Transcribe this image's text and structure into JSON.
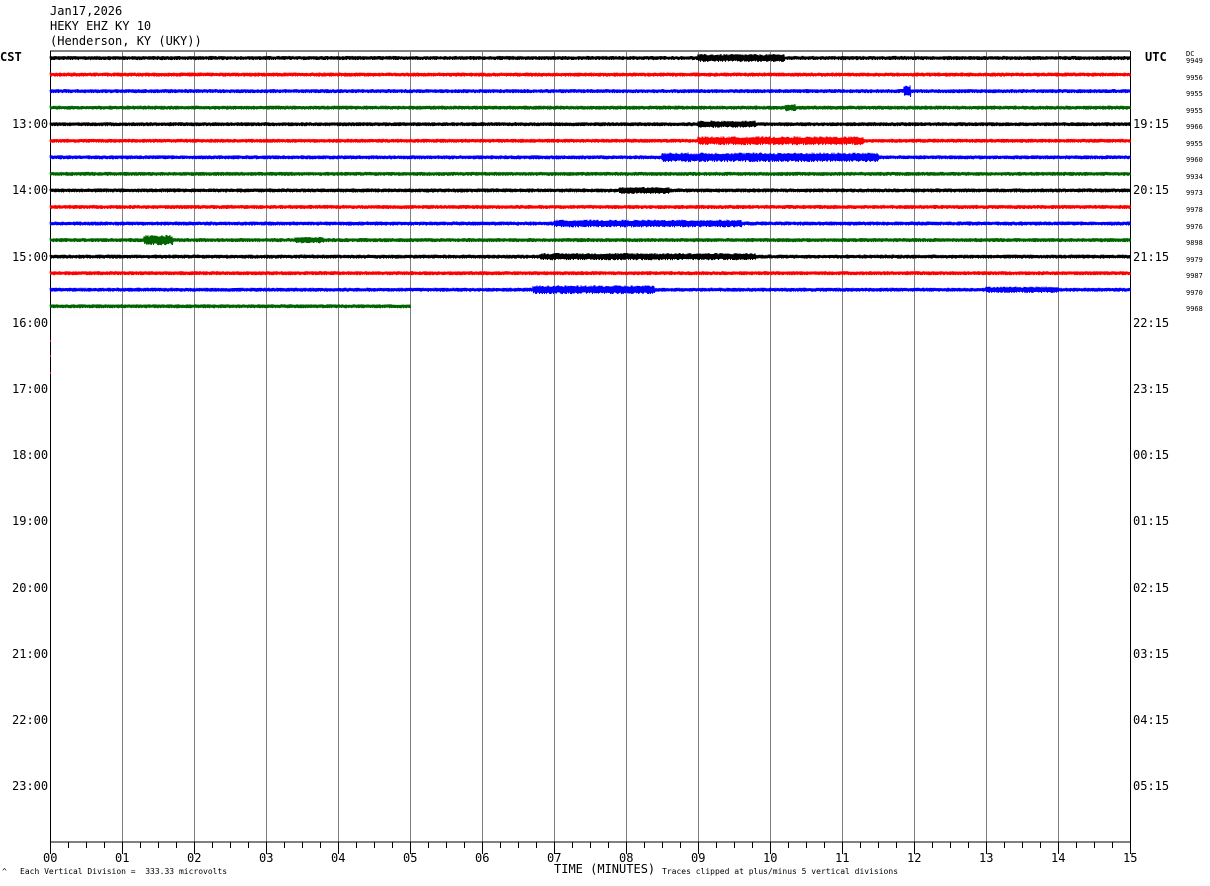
{
  "header": {
    "date": "Jan17,2026",
    "station": "HEKY EHZ KY 10",
    "location": "(Henderson, KY (UKY))"
  },
  "left_zone": "CST",
  "right_zone": "UTC",
  "dc_label": "DC",
  "footer": {
    "xlabel": "TIME (MINUTES)",
    "division_note": "Each Vertical Division =  333.33 microvolts",
    "clip_note": "Traces clipped at plus/minus 5 vertical divisions",
    "corner_mark": "^"
  },
  "chart_data": {
    "type": "line",
    "title": "HEKY EHZ KY 10",
    "xlabel": "TIME (MINUTES)",
    "ylabel": "",
    "xlim": [
      0,
      15
    ],
    "x_ticks": [
      "00",
      "01",
      "02",
      "03",
      "04",
      "05",
      "06",
      "07",
      "08",
      "09",
      "10",
      "11",
      "12",
      "13",
      "14",
      "15"
    ],
    "grid": true,
    "left_hour_labels": [
      "13:00",
      "14:00",
      "15:00",
      "16:00",
      "17:00",
      "18:00",
      "19:00",
      "20:00",
      "21:00",
      "22:00",
      "23:00"
    ],
    "right_hour_labels": [
      "19:15",
      "20:15",
      "21:15",
      "22:15",
      "23:15",
      "00:15",
      "01:15",
      "02:15",
      "03:15",
      "04:15",
      "05:15"
    ],
    "colors": [
      "#000000",
      "#ff0000",
      "#0000ff",
      "#006400"
    ],
    "traces": [
      {
        "row": 0,
        "color": "#000000",
        "end_min": 15,
        "dc": "9949",
        "bursts": [
          [
            9.0,
            10.2,
            2.0
          ]
        ]
      },
      {
        "row": 1,
        "color": "#ff0000",
        "end_min": 15,
        "dc": "9956",
        "bursts": []
      },
      {
        "row": 2,
        "color": "#0000ff",
        "end_min": 15,
        "dc": "9955",
        "bursts": [
          [
            11.85,
            11.95,
            3.0
          ]
        ]
      },
      {
        "row": 3,
        "color": "#006400",
        "end_min": 15,
        "dc": "9955",
        "bursts": [
          [
            10.2,
            10.35,
            1.8
          ]
        ]
      },
      {
        "row": 4,
        "color": "#000000",
        "end_min": 15,
        "dc": "9966",
        "bursts": [
          [
            9.0,
            9.8,
            1.8
          ]
        ]
      },
      {
        "row": 5,
        "color": "#ff0000",
        "end_min": 15,
        "dc": "9955",
        "bursts": [
          [
            9.0,
            11.3,
            2.2
          ]
        ]
      },
      {
        "row": 6,
        "color": "#0000ff",
        "end_min": 15,
        "dc": "9960",
        "bursts": [
          [
            8.5,
            11.5,
            2.4
          ]
        ]
      },
      {
        "row": 7,
        "color": "#006400",
        "end_min": 15,
        "dc": "9934",
        "bursts": []
      },
      {
        "row": 8,
        "color": "#000000",
        "end_min": 15,
        "dc": "9973",
        "bursts": [
          [
            7.9,
            8.6,
            1.7
          ]
        ]
      },
      {
        "row": 9,
        "color": "#ff0000",
        "end_min": 15,
        "dc": "9978",
        "bursts": []
      },
      {
        "row": 10,
        "color": "#0000ff",
        "end_min": 15,
        "dc": "9976",
        "bursts": [
          [
            7.0,
            9.6,
            1.9
          ]
        ]
      },
      {
        "row": 11,
        "color": "#006400",
        "end_min": 15,
        "dc": "9898",
        "bursts": [
          [
            1.3,
            1.7,
            2.6
          ],
          [
            3.4,
            3.8,
            1.6
          ]
        ]
      },
      {
        "row": 12,
        "color": "#000000",
        "end_min": 15,
        "dc": "9979",
        "bursts": [
          [
            6.8,
            9.8,
            1.8
          ]
        ]
      },
      {
        "row": 13,
        "color": "#ff0000",
        "end_min": 15,
        "dc": "9987",
        "bursts": []
      },
      {
        "row": 14,
        "color": "#0000ff",
        "end_min": 15,
        "dc": "9970",
        "bursts": [
          [
            6.7,
            8.4,
            2.2
          ],
          [
            13.0,
            14.0,
            1.6
          ]
        ]
      },
      {
        "row": 15,
        "color": "#006400",
        "end_min": 5.0,
        "dc": "9968",
        "bursts": []
      }
    ]
  }
}
